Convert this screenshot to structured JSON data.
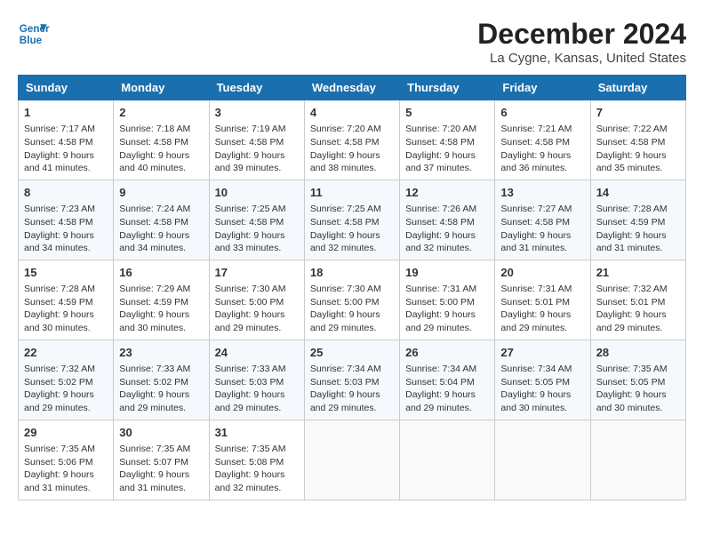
{
  "header": {
    "logo_line1": "General",
    "logo_line2": "Blue",
    "month_title": "December 2024",
    "location": "La Cygne, Kansas, United States"
  },
  "weekdays": [
    "Sunday",
    "Monday",
    "Tuesday",
    "Wednesday",
    "Thursday",
    "Friday",
    "Saturday"
  ],
  "weeks": [
    [
      {
        "day": "1",
        "sunrise": "Sunrise: 7:17 AM",
        "sunset": "Sunset: 4:58 PM",
        "daylight": "Daylight: 9 hours and 41 minutes."
      },
      {
        "day": "2",
        "sunrise": "Sunrise: 7:18 AM",
        "sunset": "Sunset: 4:58 PM",
        "daylight": "Daylight: 9 hours and 40 minutes."
      },
      {
        "day": "3",
        "sunrise": "Sunrise: 7:19 AM",
        "sunset": "Sunset: 4:58 PM",
        "daylight": "Daylight: 9 hours and 39 minutes."
      },
      {
        "day": "4",
        "sunrise": "Sunrise: 7:20 AM",
        "sunset": "Sunset: 4:58 PM",
        "daylight": "Daylight: 9 hours and 38 minutes."
      },
      {
        "day": "5",
        "sunrise": "Sunrise: 7:20 AM",
        "sunset": "Sunset: 4:58 PM",
        "daylight": "Daylight: 9 hours and 37 minutes."
      },
      {
        "day": "6",
        "sunrise": "Sunrise: 7:21 AM",
        "sunset": "Sunset: 4:58 PM",
        "daylight": "Daylight: 9 hours and 36 minutes."
      },
      {
        "day": "7",
        "sunrise": "Sunrise: 7:22 AM",
        "sunset": "Sunset: 4:58 PM",
        "daylight": "Daylight: 9 hours and 35 minutes."
      }
    ],
    [
      {
        "day": "8",
        "sunrise": "Sunrise: 7:23 AM",
        "sunset": "Sunset: 4:58 PM",
        "daylight": "Daylight: 9 hours and 34 minutes."
      },
      {
        "day": "9",
        "sunrise": "Sunrise: 7:24 AM",
        "sunset": "Sunset: 4:58 PM",
        "daylight": "Daylight: 9 hours and 34 minutes."
      },
      {
        "day": "10",
        "sunrise": "Sunrise: 7:25 AM",
        "sunset": "Sunset: 4:58 PM",
        "daylight": "Daylight: 9 hours and 33 minutes."
      },
      {
        "day": "11",
        "sunrise": "Sunrise: 7:25 AM",
        "sunset": "Sunset: 4:58 PM",
        "daylight": "Daylight: 9 hours and 32 minutes."
      },
      {
        "day": "12",
        "sunrise": "Sunrise: 7:26 AM",
        "sunset": "Sunset: 4:58 PM",
        "daylight": "Daylight: 9 hours and 32 minutes."
      },
      {
        "day": "13",
        "sunrise": "Sunrise: 7:27 AM",
        "sunset": "Sunset: 4:58 PM",
        "daylight": "Daylight: 9 hours and 31 minutes."
      },
      {
        "day": "14",
        "sunrise": "Sunrise: 7:28 AM",
        "sunset": "Sunset: 4:59 PM",
        "daylight": "Daylight: 9 hours and 31 minutes."
      }
    ],
    [
      {
        "day": "15",
        "sunrise": "Sunrise: 7:28 AM",
        "sunset": "Sunset: 4:59 PM",
        "daylight": "Daylight: 9 hours and 30 minutes."
      },
      {
        "day": "16",
        "sunrise": "Sunrise: 7:29 AM",
        "sunset": "Sunset: 4:59 PM",
        "daylight": "Daylight: 9 hours and 30 minutes."
      },
      {
        "day": "17",
        "sunrise": "Sunrise: 7:30 AM",
        "sunset": "Sunset: 5:00 PM",
        "daylight": "Daylight: 9 hours and 29 minutes."
      },
      {
        "day": "18",
        "sunrise": "Sunrise: 7:30 AM",
        "sunset": "Sunset: 5:00 PM",
        "daylight": "Daylight: 9 hours and 29 minutes."
      },
      {
        "day": "19",
        "sunrise": "Sunrise: 7:31 AM",
        "sunset": "Sunset: 5:00 PM",
        "daylight": "Daylight: 9 hours and 29 minutes."
      },
      {
        "day": "20",
        "sunrise": "Sunrise: 7:31 AM",
        "sunset": "Sunset: 5:01 PM",
        "daylight": "Daylight: 9 hours and 29 minutes."
      },
      {
        "day": "21",
        "sunrise": "Sunrise: 7:32 AM",
        "sunset": "Sunset: 5:01 PM",
        "daylight": "Daylight: 9 hours and 29 minutes."
      }
    ],
    [
      {
        "day": "22",
        "sunrise": "Sunrise: 7:32 AM",
        "sunset": "Sunset: 5:02 PM",
        "daylight": "Daylight: 9 hours and 29 minutes."
      },
      {
        "day": "23",
        "sunrise": "Sunrise: 7:33 AM",
        "sunset": "Sunset: 5:02 PM",
        "daylight": "Daylight: 9 hours and 29 minutes."
      },
      {
        "day": "24",
        "sunrise": "Sunrise: 7:33 AM",
        "sunset": "Sunset: 5:03 PM",
        "daylight": "Daylight: 9 hours and 29 minutes."
      },
      {
        "day": "25",
        "sunrise": "Sunrise: 7:34 AM",
        "sunset": "Sunset: 5:03 PM",
        "daylight": "Daylight: 9 hours and 29 minutes."
      },
      {
        "day": "26",
        "sunrise": "Sunrise: 7:34 AM",
        "sunset": "Sunset: 5:04 PM",
        "daylight": "Daylight: 9 hours and 29 minutes."
      },
      {
        "day": "27",
        "sunrise": "Sunrise: 7:34 AM",
        "sunset": "Sunset: 5:05 PM",
        "daylight": "Daylight: 9 hours and 30 minutes."
      },
      {
        "day": "28",
        "sunrise": "Sunrise: 7:35 AM",
        "sunset": "Sunset: 5:05 PM",
        "daylight": "Daylight: 9 hours and 30 minutes."
      }
    ],
    [
      {
        "day": "29",
        "sunrise": "Sunrise: 7:35 AM",
        "sunset": "Sunset: 5:06 PM",
        "daylight": "Daylight: 9 hours and 31 minutes."
      },
      {
        "day": "30",
        "sunrise": "Sunrise: 7:35 AM",
        "sunset": "Sunset: 5:07 PM",
        "daylight": "Daylight: 9 hours and 31 minutes."
      },
      {
        "day": "31",
        "sunrise": "Sunrise: 7:35 AM",
        "sunset": "Sunset: 5:08 PM",
        "daylight": "Daylight: 9 hours and 32 minutes."
      },
      null,
      null,
      null,
      null
    ]
  ]
}
